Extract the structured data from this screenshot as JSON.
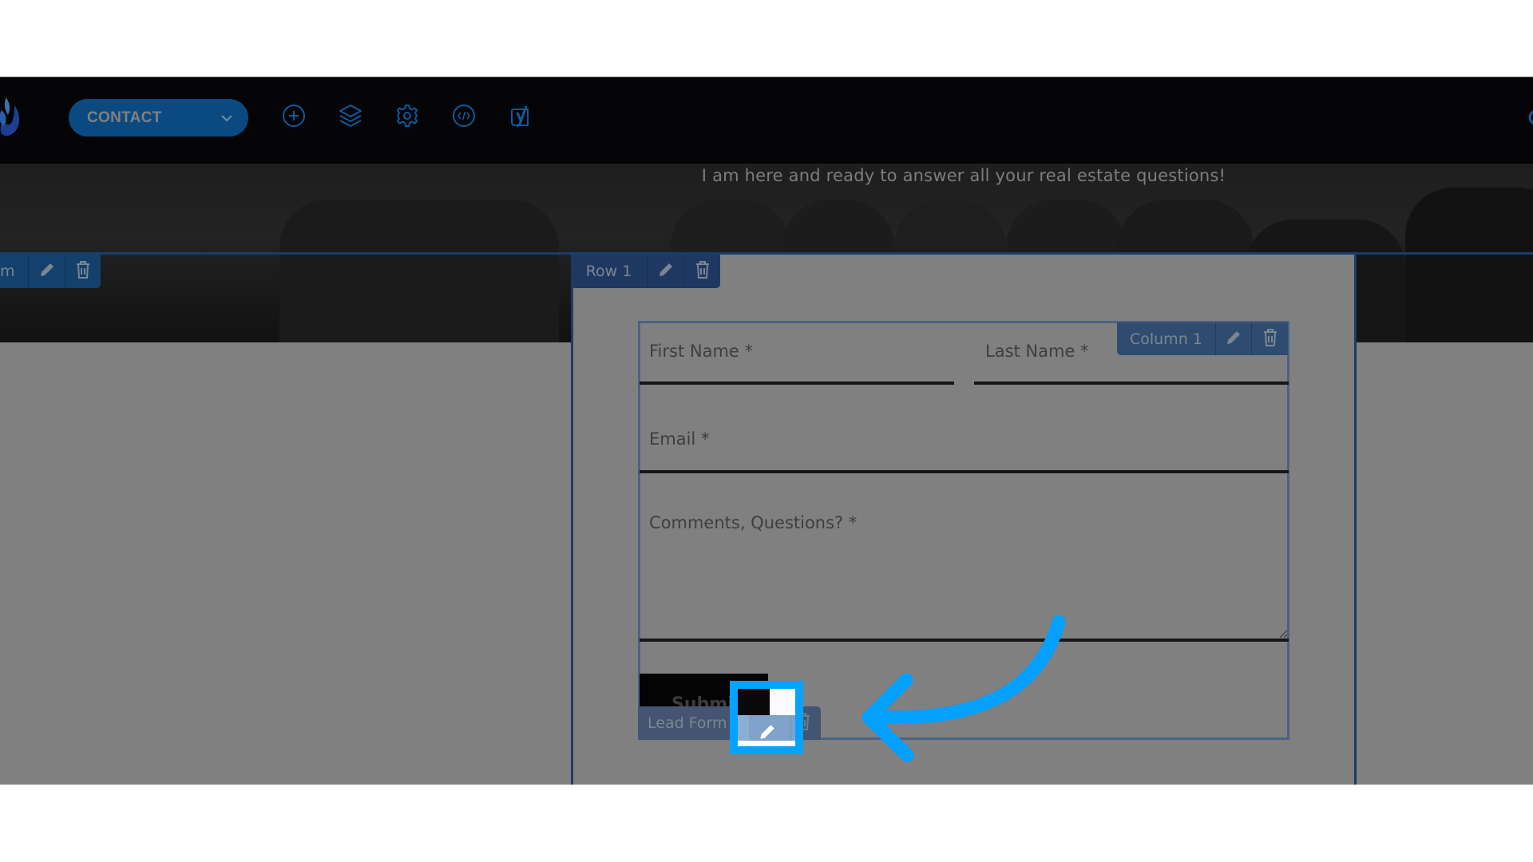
{
  "toolbar": {
    "page_selector": {
      "label": "CONTACT",
      "icon": "chevron-down-icon"
    },
    "icons": [
      "add-icon",
      "layers-icon",
      "settings-gear-icon",
      "code-icon",
      "yoast-seo-icon"
    ],
    "accent_color": "#0a4a80"
  },
  "hero": {
    "text": "I am here and ready to answer all your real estate questions!"
  },
  "section_toolbar": {
    "label": "m",
    "edit_icon": "pencil-icon",
    "delete_icon": "trash-icon"
  },
  "row_toolbar": {
    "label": "Row 1",
    "edit_icon": "pencil-icon",
    "delete_icon": "trash-icon"
  },
  "column_toolbar": {
    "label": "Column 1",
    "edit_icon": "pencil-icon",
    "delete_icon": "trash-icon"
  },
  "form": {
    "fields": [
      {
        "label": "First Name *"
      },
      {
        "label": "Last Name *"
      },
      {
        "label": "Email *"
      },
      {
        "label": "Comments, Questions? *"
      }
    ],
    "submit_label": "Submit"
  },
  "element_toolbar": {
    "label": "Lead Form",
    "edit_icon": "pencil-icon",
    "delete_icon": "trash-icon"
  },
  "annotation": {
    "highlight_color": "#03a3ff",
    "target": "lead-form-edit-button"
  }
}
